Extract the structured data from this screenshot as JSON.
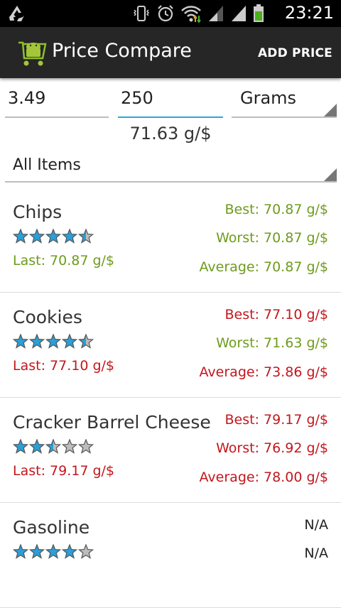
{
  "status_bar": {
    "time": "23:21"
  },
  "action_bar": {
    "title": "Price Compare",
    "add_price_label": "ADD PRICE"
  },
  "inputs": {
    "price_value": "3.49",
    "amount_value": "250",
    "unit_selected": "Grams"
  },
  "result_text": "71.63 g/$",
  "filter": {
    "selected": "All Items"
  },
  "colors": {
    "good": "#6e9b1c",
    "bad": "#c2171d",
    "star_on": "#2a9fd8",
    "star_off": "#bdbdbd"
  },
  "items": [
    {
      "name": "Chips",
      "rating": 4.5,
      "last": "Last: 70.87 g/$",
      "last_color": "green",
      "best": "Best: 70.87 g/$",
      "best_color": "green",
      "worst": "Worst: 70.87 g/$",
      "worst_color": "green",
      "average": "Average: 70.87 g/$",
      "average_color": "green"
    },
    {
      "name": "Cookies",
      "rating": 4.5,
      "last": "Last: 77.10 g/$",
      "last_color": "red",
      "best": "Best: 77.10 g/$",
      "best_color": "red",
      "worst": "Worst: 71.63 g/$",
      "worst_color": "green",
      "average": "Average: 73.86 g/$",
      "average_color": "red"
    },
    {
      "name": "Cracker Barrel Cheese",
      "rating": 2.5,
      "last": "Last: 79.17 g/$",
      "last_color": "red",
      "best": "Best: 79.17 g/$",
      "best_color": "red",
      "worst": "Worst: 76.92 g/$",
      "worst_color": "red",
      "average": "Average: 78.00 g/$",
      "average_color": "red"
    },
    {
      "name": "Gasoline",
      "rating": 4,
      "last": "",
      "last_color": "dark",
      "best": "N/A",
      "best_color": "dark",
      "worst": "N/A",
      "worst_color": "dark",
      "average": "",
      "average_color": "dark"
    }
  ]
}
